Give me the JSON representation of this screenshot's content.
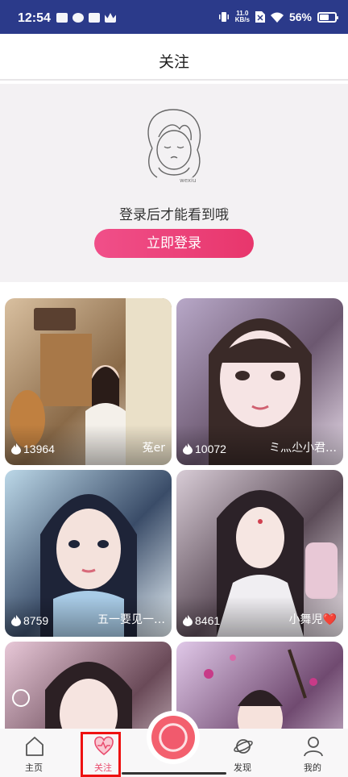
{
  "status_bar": {
    "time": "12:54",
    "speed_value": "11.0",
    "speed_unit": "KB/s",
    "battery": "56%"
  },
  "header": {
    "title": "关注"
  },
  "login_prompt": {
    "tip": "登录后才能看到哦",
    "button_label": "立即登录",
    "illustration_signature": "wexiu"
  },
  "cards": [
    {
      "heat": "13964",
      "name": "菟er",
      "colors": [
        "#d9c0a0",
        "#8a6a48",
        "#f4ece0"
      ]
    },
    {
      "heat": "10072",
      "name": "ミ灬尐小君…",
      "colors": [
        "#b8a8c8",
        "#6c5870",
        "#e8dcea"
      ]
    },
    {
      "heat": "8759",
      "name": "五一要见一…",
      "colors": [
        "#bcd8e8",
        "#3a4c68",
        "#e6f0f6"
      ]
    },
    {
      "heat": "8461",
      "name": "小舞児❤️",
      "colors": [
        "#d8ccd6",
        "#5c4c58",
        "#f2eaf0"
      ]
    },
    {
      "heat": "",
      "name": "",
      "colors": [
        "#e8c8d8",
        "#6a4a58",
        "#f8eaf0"
      ]
    },
    {
      "heat": "",
      "name": "",
      "colors": [
        "#e0c8e8",
        "#704a70",
        "#f4e8f6"
      ]
    }
  ],
  "bottom_nav": {
    "home": "主页",
    "follow": "关注",
    "discover": "发现",
    "mine": "我的"
  },
  "colors": {
    "accent": "#e94b6d",
    "status_bar": "#2b3a8a",
    "login_bg": "#f3f1f3"
  }
}
